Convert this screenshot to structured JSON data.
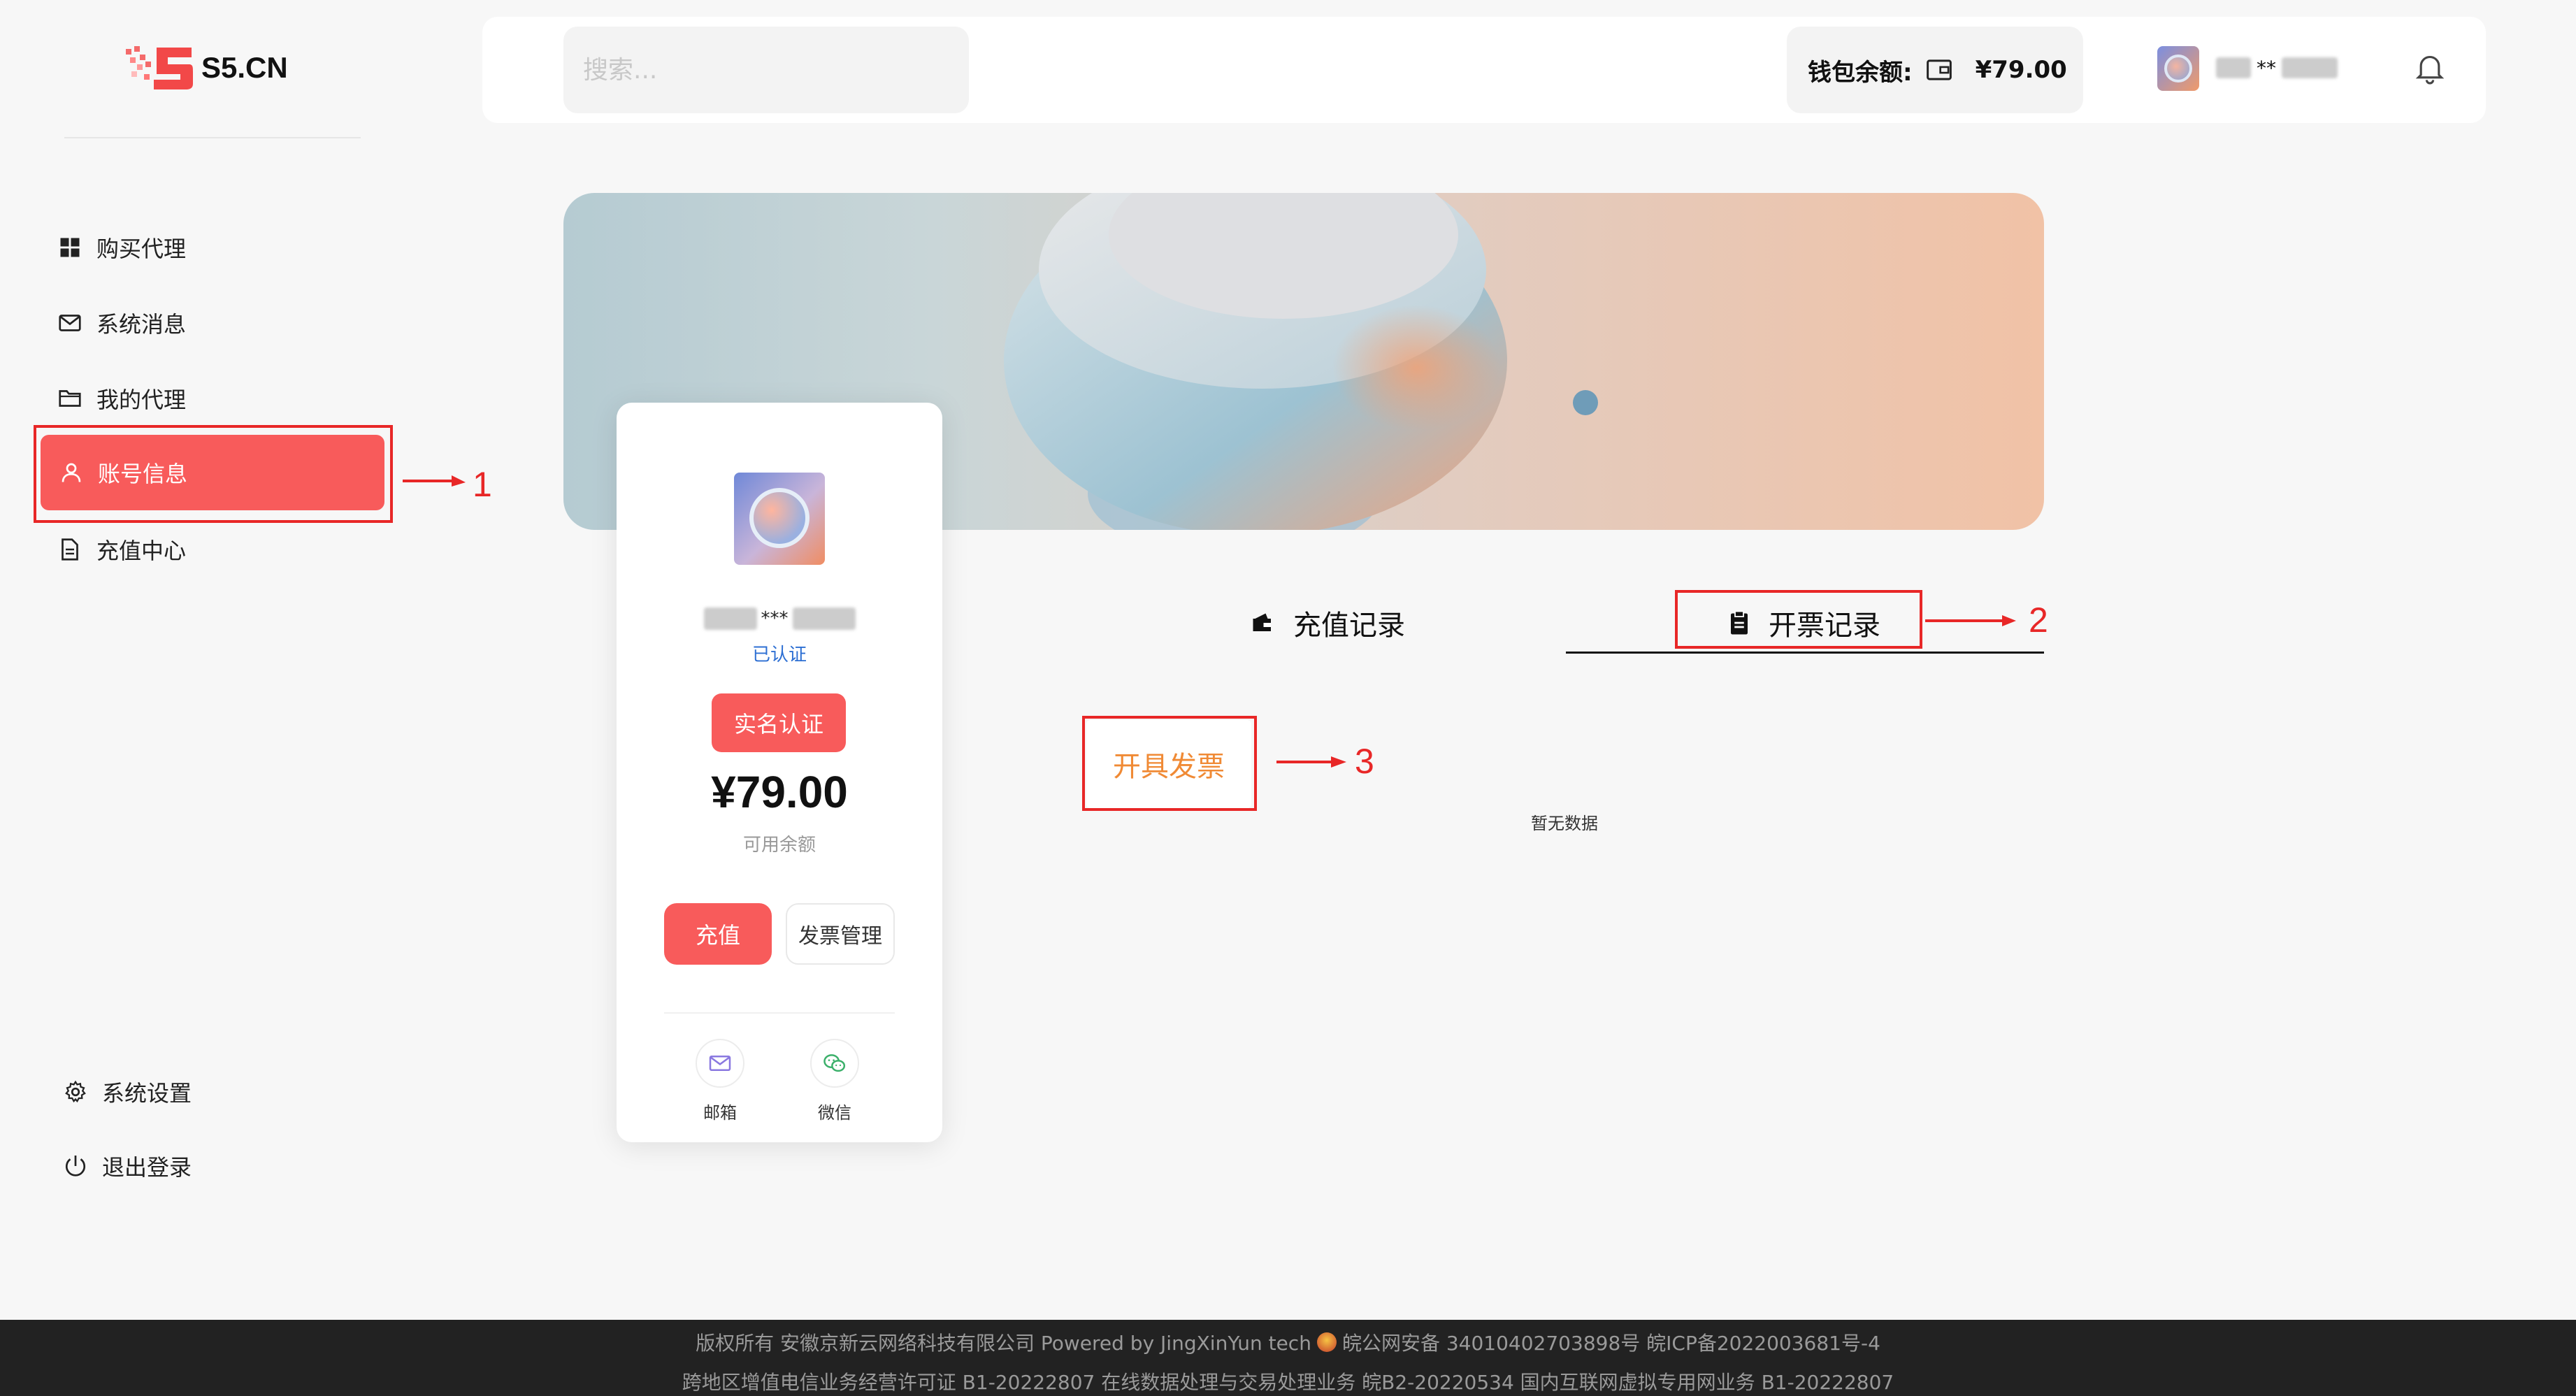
{
  "brand": {
    "name": "S5.CN"
  },
  "sidebar": {
    "items": [
      {
        "label": "购买代理",
        "icon": "grid-icon"
      },
      {
        "label": "系统消息",
        "icon": "mail-icon"
      },
      {
        "label": "我的代理",
        "icon": "folder-icon"
      },
      {
        "label": "账号信息",
        "icon": "user-icon",
        "active": true
      },
      {
        "label": "充值中心",
        "icon": "document-icon"
      }
    ],
    "bottom_items": [
      {
        "label": "系统设置",
        "icon": "gear-icon"
      },
      {
        "label": "退出登录",
        "icon": "power-icon"
      }
    ]
  },
  "header": {
    "search_placeholder": "搜索...",
    "wallet_label": "钱包余额:",
    "wallet_amount": "¥79.00",
    "username_masked": "**"
  },
  "profile": {
    "name_masked": "***",
    "verified_text": "已认证",
    "realname_button": "实名认证",
    "balance": "¥79.00",
    "balance_label": "可用余额",
    "recharge_button": "充值",
    "invoice_mgmt_button": "发票管理",
    "contacts": [
      {
        "label": "邮箱",
        "icon": "mail-icon"
      },
      {
        "label": "微信",
        "icon": "wechat-icon"
      }
    ]
  },
  "tabs": [
    {
      "label": "充值记录",
      "icon": "wallet-icon"
    },
    {
      "label": "开票记录",
      "icon": "clipboard-icon",
      "active": true
    }
  ],
  "invoice_button": "开具发票",
  "empty_text": "暂无数据",
  "annotations": {
    "one": "1",
    "two": "2",
    "three": "3"
  },
  "footer": {
    "line1": "版权所有 安徽京新云网络科技有限公司 Powered by JingXinYun tech",
    "line1b": "皖公网安备 34010402703898号 皖ICP备2022003681号-4",
    "line2": "跨地区增值电信业务经营许可证 B1-20222807 在线数据处理与交易处理业务 皖B2-20220534 国内互联网虚拟专用网业务 B1-20222807"
  },
  "colors": {
    "accent": "#f85b5b",
    "annotation": "#e82727",
    "invoice_text": "#f08a35"
  }
}
